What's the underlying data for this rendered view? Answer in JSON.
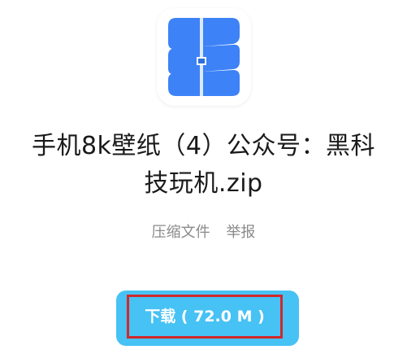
{
  "app_icon": {
    "icon": "archive-icon",
    "colors": {
      "primary": "#3d82f6",
      "strap": "#dbe9fb",
      "lock": "#2e6fd8"
    }
  },
  "file": {
    "title_line1": "手机8k壁纸（4）公众号：黑科",
    "title_line2": "技玩机.zip"
  },
  "meta": {
    "type_label": "压缩文件",
    "report_label": "举报"
  },
  "download": {
    "label": "下载 ( 72.0 M )",
    "button_color": "#47c2f4",
    "highlight_color": "#d1282a"
  }
}
